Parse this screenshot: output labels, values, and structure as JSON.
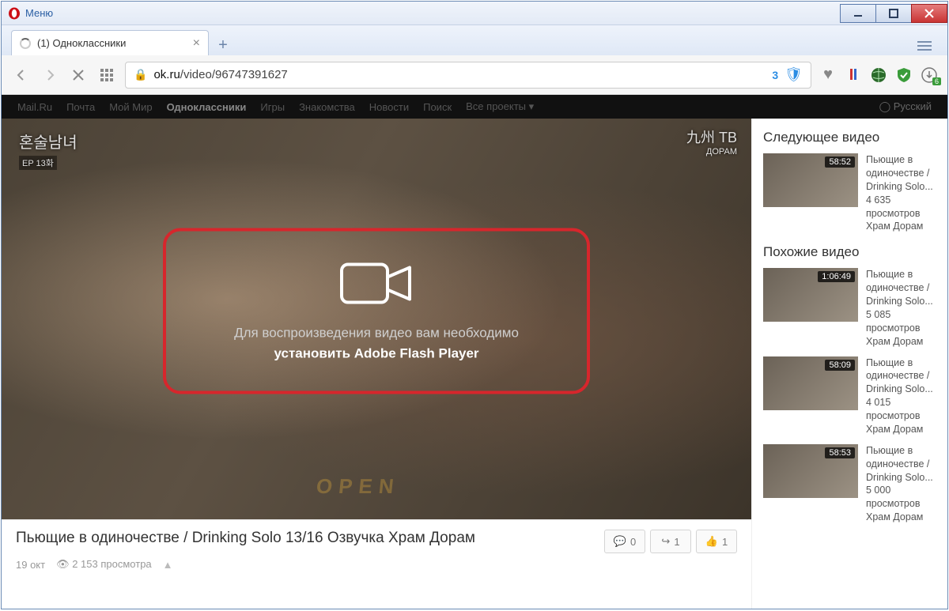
{
  "window": {
    "menu_label": "Меню"
  },
  "tab": {
    "title": "(1) Одноклассники"
  },
  "toolbar": {
    "url_domain": "ok.ru",
    "url_path": "/video/96747391627",
    "badge_count": "3",
    "ext_download_badge": "6"
  },
  "topnav": {
    "items": [
      "Mail.Ru",
      "Почта",
      "Мой Мир",
      "Одноклассники",
      "Игры",
      "Знакомства",
      "Новости",
      "Поиск",
      "Все проекты ▾"
    ],
    "right": "◯ Русский"
  },
  "player": {
    "watermark_left_main": "혼술남녀",
    "watermark_left_sub": "EP 13화",
    "watermark_right_main": "九州 ТВ",
    "watermark_right_sub": "ДОРАМ",
    "open_sign": "OPEN",
    "flash_line1": "Для воспроизведения видео вам необходимо",
    "flash_line2": "установить Adobe Flash Player"
  },
  "video": {
    "title": "Пьющие в одиночестве / Drinking Solo 13/16 Озвучка Храм Дорам",
    "comments": "0",
    "shares": "1",
    "likes": "1",
    "date": "19 окт",
    "views": "2 153 просмотра"
  },
  "sidebar": {
    "next_title": "Следующее видео",
    "related_title": "Похожие видео",
    "next": [
      {
        "duration": "58:52",
        "title": "Пьющие в одиночестве / Drinking Solo...",
        "extra": "4 635 просмотров",
        "extra2": "Храм Дорам"
      }
    ],
    "related": [
      {
        "duration": "1:06:49",
        "title": "Пьющие в одиночестве / Drinking Solo...",
        "extra": "5 085 просмотров",
        "extra2": "Храм Дорам"
      },
      {
        "duration": "58:09",
        "title": "Пьющие в одиночестве / Drinking Solo...",
        "extra": "4 015 просмотров",
        "extra2": "Храм Дорам"
      },
      {
        "duration": "58:53",
        "title": "Пьющие в одиночестве / Drinking Solo...",
        "extra": "5 000 просмотров",
        "extra2": "Храм Дорам"
      }
    ]
  }
}
